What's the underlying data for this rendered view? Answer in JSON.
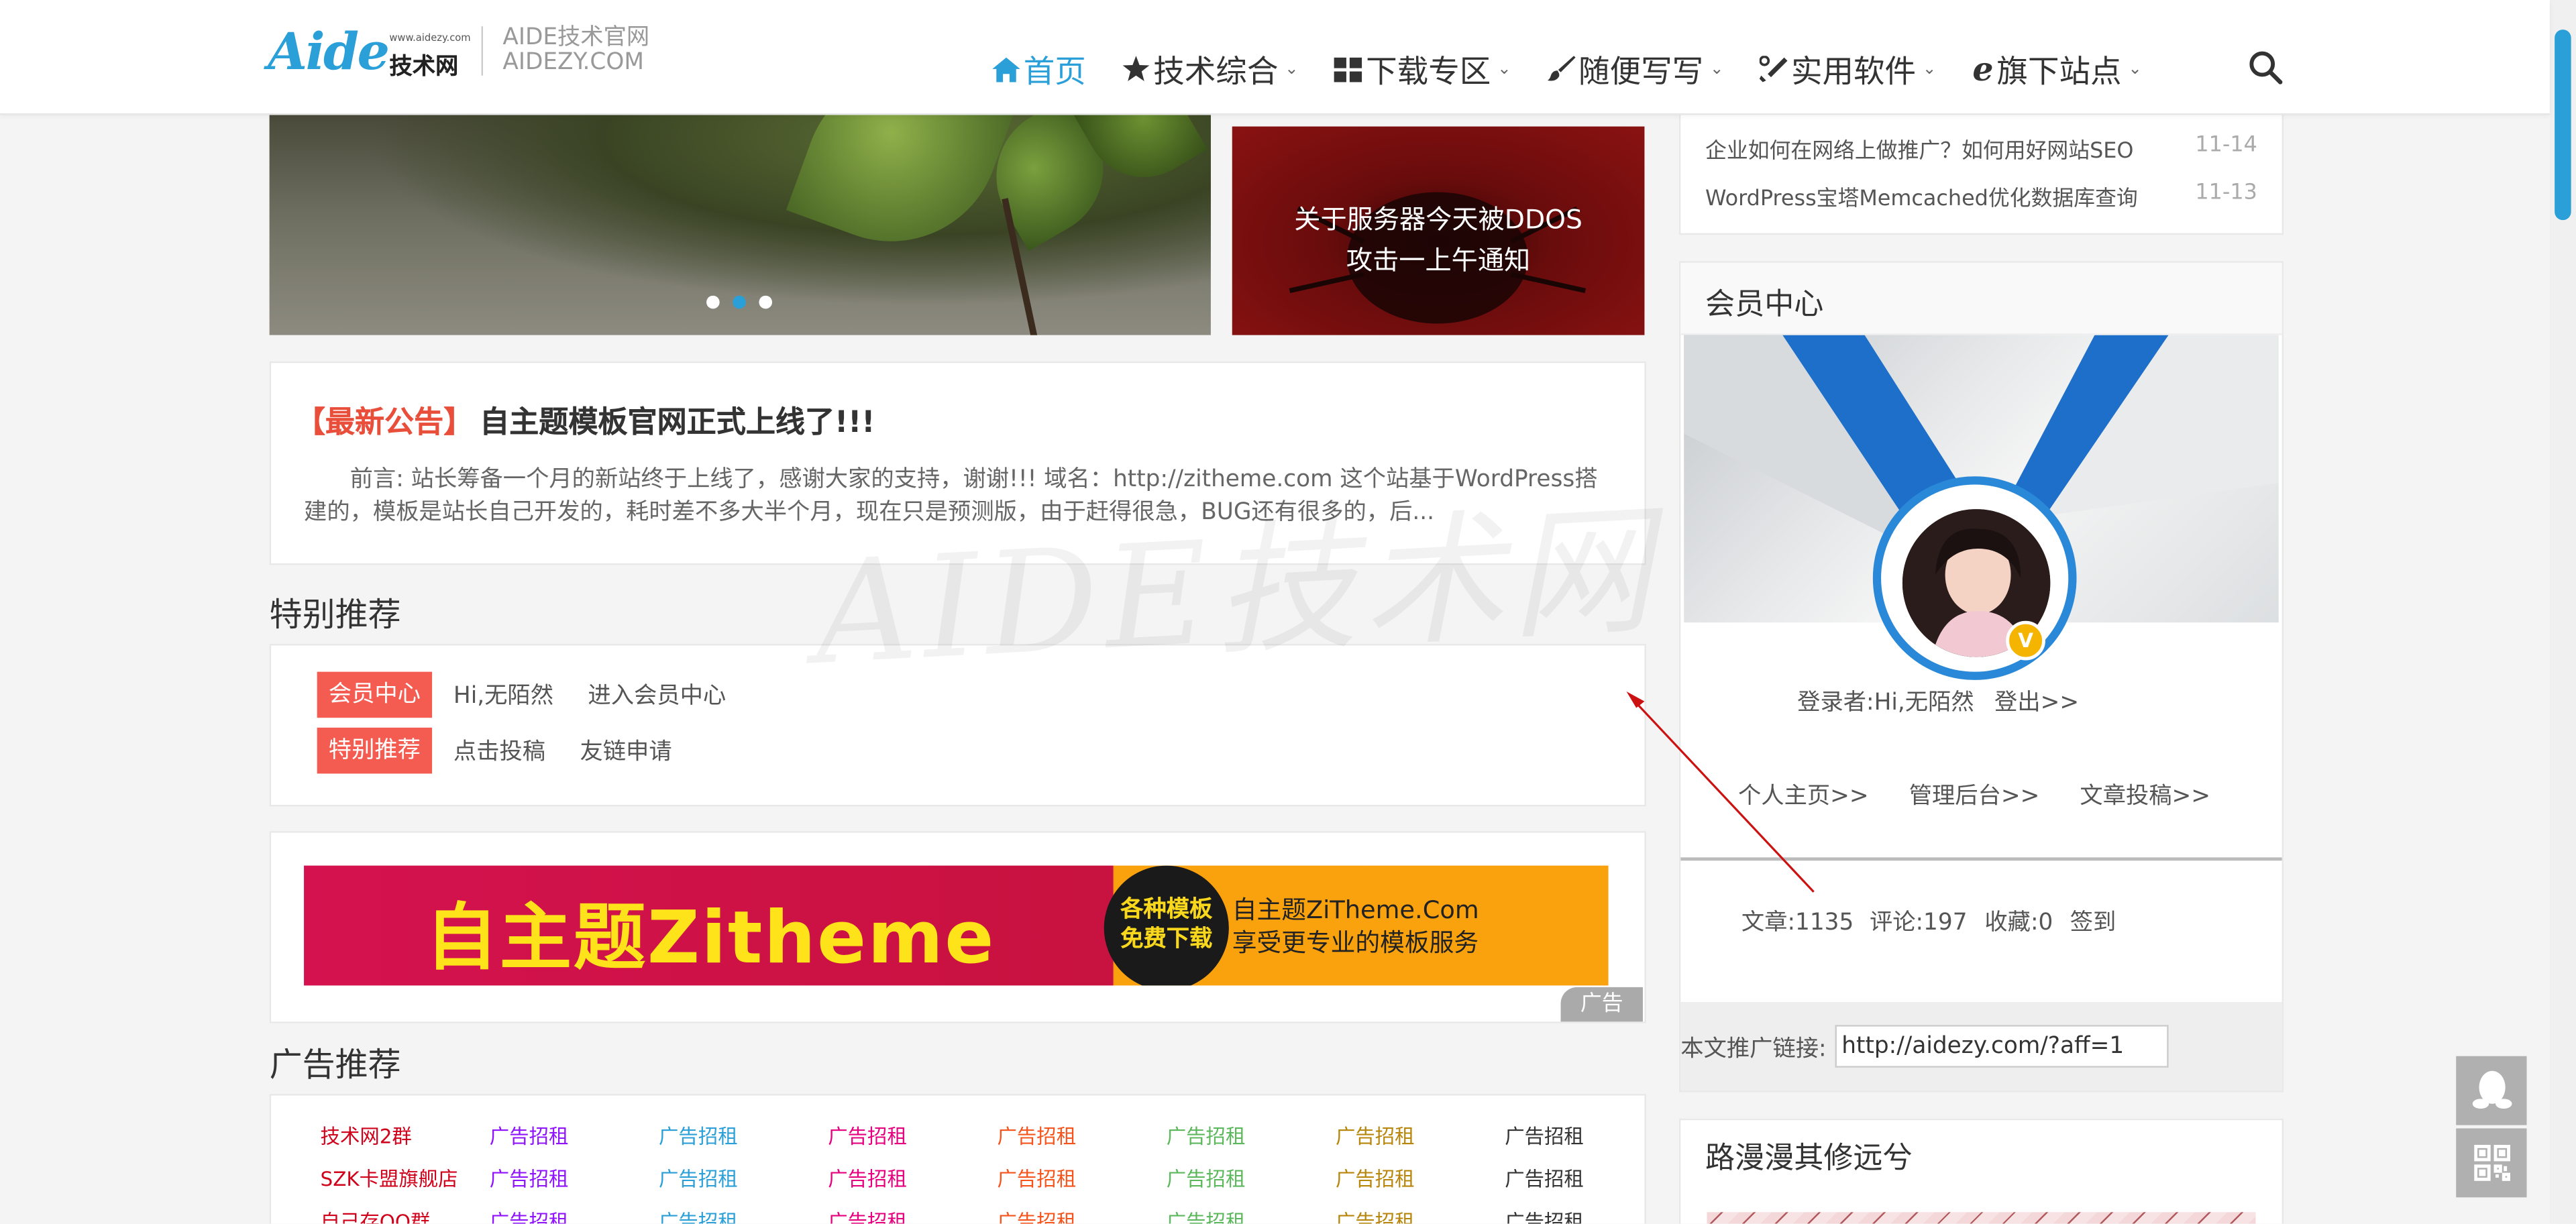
{
  "header": {
    "logo_text": "Aide",
    "logo_sub": "www.aidezy.com",
    "logo_cn": "技术网",
    "site_name_line1": "AIDE技术官网",
    "site_name_line2": "AIDEZY.COM",
    "nav": [
      {
        "label": "首页",
        "icon": "home-icon",
        "active": true
      },
      {
        "label": "技术综合",
        "icon": "star-icon"
      },
      {
        "label": "下载专区",
        "icon": "grid-icon"
      },
      {
        "label": "随便写写",
        "icon": "brush-icon"
      },
      {
        "label": "实用软件",
        "icon": "wrench-icon"
      },
      {
        "label": "旗下站点",
        "icon": "ie-icon"
      }
    ]
  },
  "slider": {
    "promo_text": "关于服务器今天被DDOS攻击一上午通知"
  },
  "announcement": {
    "tag": "【最新公告】",
    "title": "自主题模板官网正式上线了!!!",
    "body": "前言: 站长筹备一个月的新站终于上线了，感谢大家的支持，谢谢!!! 域名：http://zitheme.com 这个站基于WordPress搭建的，模板是站长自己开发的，耗时差不多大半个月，现在只是预测版，由于赶得很急，BUG还有很多的，后..."
  },
  "special": {
    "title": "特别推荐",
    "row1": {
      "tag": "会员中心",
      "links": [
        "Hi,无陌然",
        "进入会员中心"
      ]
    },
    "row2": {
      "tag": "特别推荐",
      "links": [
        "点击投稿",
        "友链申请"
      ]
    }
  },
  "banner_ad": {
    "main_text": "自主题Zitheme",
    "circle_line1": "各种模板",
    "circle_line2": "免费下载",
    "right_line1": "自主题ZiTheme.Com",
    "right_line2": "享受更专业的模板服务",
    "label": "广告"
  },
  "ads": {
    "title": "广告推荐",
    "row1": [
      {
        "text": "技术网2群",
        "color": "#d0021b"
      },
      {
        "text": "广告招租",
        "color": "#9013fe"
      },
      {
        "text": "广告招租",
        "color": "#2a9fd8"
      },
      {
        "text": "广告招租",
        "color": "#e6007e"
      },
      {
        "text": "广告招租",
        "color": "#f5541c"
      },
      {
        "text": "广告招租",
        "color": "#5cb85c"
      },
      {
        "text": "广告招租",
        "color": "#b8860b"
      },
      {
        "text": "广告招租",
        "color": "#333333"
      }
    ],
    "row2": [
      {
        "text": "SZK卡盟旗舰店",
        "color": "#d0021b"
      },
      {
        "text": "广告招租",
        "color": "#9013fe"
      },
      {
        "text": "广告招租",
        "color": "#2a9fd8"
      },
      {
        "text": "广告招租",
        "color": "#e6007e"
      },
      {
        "text": "广告招租",
        "color": "#f5541c"
      },
      {
        "text": "广告招租",
        "color": "#5cb85c"
      },
      {
        "text": "广告招租",
        "color": "#b8860b"
      },
      {
        "text": "广告招租",
        "color": "#333333"
      }
    ],
    "row3": [
      {
        "text": "自己存QQ群",
        "color": "#d0021b"
      },
      {
        "text": "广告招租",
        "color": "#9013fe"
      },
      {
        "text": "广告招租",
        "color": "#2a9fd8"
      },
      {
        "text": "广告招租",
        "color": "#e6007e"
      },
      {
        "text": "广告招租",
        "color": "#f5541c"
      },
      {
        "text": "广告招租",
        "color": "#5cb85c"
      },
      {
        "text": "广告招租",
        "color": "#b8860b"
      },
      {
        "text": "广告招租",
        "color": "#333333"
      }
    ]
  },
  "sidebar": {
    "news": [
      {
        "title": "企业如何在网络上做推广？如何用好网站SEO",
        "date": "11-14"
      },
      {
        "title": "WordPress宝塔Memcached优化数据库查询",
        "date": "11-13"
      }
    ],
    "member": {
      "title": "会员中心",
      "login_text": "登录者:Hi,无陌然",
      "logout": "登出>>",
      "links": [
        "个人主页>>",
        "管理后台>>",
        "文章投稿>>"
      ],
      "stats": {
        "articles": "文章:1135",
        "comments": "评论:197",
        "favorites": "收藏:0",
        "checkin": "签到"
      },
      "promo_label": "本文推广链接:",
      "promo_value": "http://aidezy.com/?aff=1"
    },
    "road_title": "路漫漫其修远兮"
  },
  "watermark": "AIDE技术网",
  "colors": {
    "accent": "#2a9fd8",
    "tag_red": "#f45c52",
    "ann_red": "#e94e3b"
  }
}
